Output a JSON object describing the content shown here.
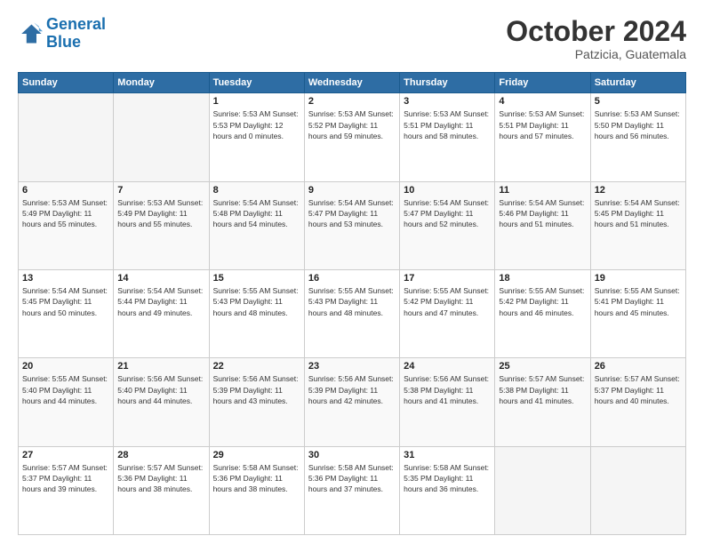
{
  "logo": {
    "line1": "General",
    "line2": "Blue"
  },
  "header": {
    "month": "October 2024",
    "location": "Patzicia, Guatemala"
  },
  "days_of_week": [
    "Sunday",
    "Monday",
    "Tuesday",
    "Wednesday",
    "Thursday",
    "Friday",
    "Saturday"
  ],
  "weeks": [
    [
      {
        "day": "",
        "info": ""
      },
      {
        "day": "",
        "info": ""
      },
      {
        "day": "1",
        "info": "Sunrise: 5:53 AM\nSunset: 5:53 PM\nDaylight: 12 hours\nand 0 minutes."
      },
      {
        "day": "2",
        "info": "Sunrise: 5:53 AM\nSunset: 5:52 PM\nDaylight: 11 hours\nand 59 minutes."
      },
      {
        "day": "3",
        "info": "Sunrise: 5:53 AM\nSunset: 5:51 PM\nDaylight: 11 hours\nand 58 minutes."
      },
      {
        "day": "4",
        "info": "Sunrise: 5:53 AM\nSunset: 5:51 PM\nDaylight: 11 hours\nand 57 minutes."
      },
      {
        "day": "5",
        "info": "Sunrise: 5:53 AM\nSunset: 5:50 PM\nDaylight: 11 hours\nand 56 minutes."
      }
    ],
    [
      {
        "day": "6",
        "info": "Sunrise: 5:53 AM\nSunset: 5:49 PM\nDaylight: 11 hours\nand 55 minutes."
      },
      {
        "day": "7",
        "info": "Sunrise: 5:53 AM\nSunset: 5:49 PM\nDaylight: 11 hours\nand 55 minutes."
      },
      {
        "day": "8",
        "info": "Sunrise: 5:54 AM\nSunset: 5:48 PM\nDaylight: 11 hours\nand 54 minutes."
      },
      {
        "day": "9",
        "info": "Sunrise: 5:54 AM\nSunset: 5:47 PM\nDaylight: 11 hours\nand 53 minutes."
      },
      {
        "day": "10",
        "info": "Sunrise: 5:54 AM\nSunset: 5:47 PM\nDaylight: 11 hours\nand 52 minutes."
      },
      {
        "day": "11",
        "info": "Sunrise: 5:54 AM\nSunset: 5:46 PM\nDaylight: 11 hours\nand 51 minutes."
      },
      {
        "day": "12",
        "info": "Sunrise: 5:54 AM\nSunset: 5:45 PM\nDaylight: 11 hours\nand 51 minutes."
      }
    ],
    [
      {
        "day": "13",
        "info": "Sunrise: 5:54 AM\nSunset: 5:45 PM\nDaylight: 11 hours\nand 50 minutes."
      },
      {
        "day": "14",
        "info": "Sunrise: 5:54 AM\nSunset: 5:44 PM\nDaylight: 11 hours\nand 49 minutes."
      },
      {
        "day": "15",
        "info": "Sunrise: 5:55 AM\nSunset: 5:43 PM\nDaylight: 11 hours\nand 48 minutes."
      },
      {
        "day": "16",
        "info": "Sunrise: 5:55 AM\nSunset: 5:43 PM\nDaylight: 11 hours\nand 48 minutes."
      },
      {
        "day": "17",
        "info": "Sunrise: 5:55 AM\nSunset: 5:42 PM\nDaylight: 11 hours\nand 47 minutes."
      },
      {
        "day": "18",
        "info": "Sunrise: 5:55 AM\nSunset: 5:42 PM\nDaylight: 11 hours\nand 46 minutes."
      },
      {
        "day": "19",
        "info": "Sunrise: 5:55 AM\nSunset: 5:41 PM\nDaylight: 11 hours\nand 45 minutes."
      }
    ],
    [
      {
        "day": "20",
        "info": "Sunrise: 5:55 AM\nSunset: 5:40 PM\nDaylight: 11 hours\nand 44 minutes."
      },
      {
        "day": "21",
        "info": "Sunrise: 5:56 AM\nSunset: 5:40 PM\nDaylight: 11 hours\nand 44 minutes."
      },
      {
        "day": "22",
        "info": "Sunrise: 5:56 AM\nSunset: 5:39 PM\nDaylight: 11 hours\nand 43 minutes."
      },
      {
        "day": "23",
        "info": "Sunrise: 5:56 AM\nSunset: 5:39 PM\nDaylight: 11 hours\nand 42 minutes."
      },
      {
        "day": "24",
        "info": "Sunrise: 5:56 AM\nSunset: 5:38 PM\nDaylight: 11 hours\nand 41 minutes."
      },
      {
        "day": "25",
        "info": "Sunrise: 5:57 AM\nSunset: 5:38 PM\nDaylight: 11 hours\nand 41 minutes."
      },
      {
        "day": "26",
        "info": "Sunrise: 5:57 AM\nSunset: 5:37 PM\nDaylight: 11 hours\nand 40 minutes."
      }
    ],
    [
      {
        "day": "27",
        "info": "Sunrise: 5:57 AM\nSunset: 5:37 PM\nDaylight: 11 hours\nand 39 minutes."
      },
      {
        "day": "28",
        "info": "Sunrise: 5:57 AM\nSunset: 5:36 PM\nDaylight: 11 hours\nand 38 minutes."
      },
      {
        "day": "29",
        "info": "Sunrise: 5:58 AM\nSunset: 5:36 PM\nDaylight: 11 hours\nand 38 minutes."
      },
      {
        "day": "30",
        "info": "Sunrise: 5:58 AM\nSunset: 5:36 PM\nDaylight: 11 hours\nand 37 minutes."
      },
      {
        "day": "31",
        "info": "Sunrise: 5:58 AM\nSunset: 5:35 PM\nDaylight: 11 hours\nand 36 minutes."
      },
      {
        "day": "",
        "info": ""
      },
      {
        "day": "",
        "info": ""
      }
    ]
  ]
}
